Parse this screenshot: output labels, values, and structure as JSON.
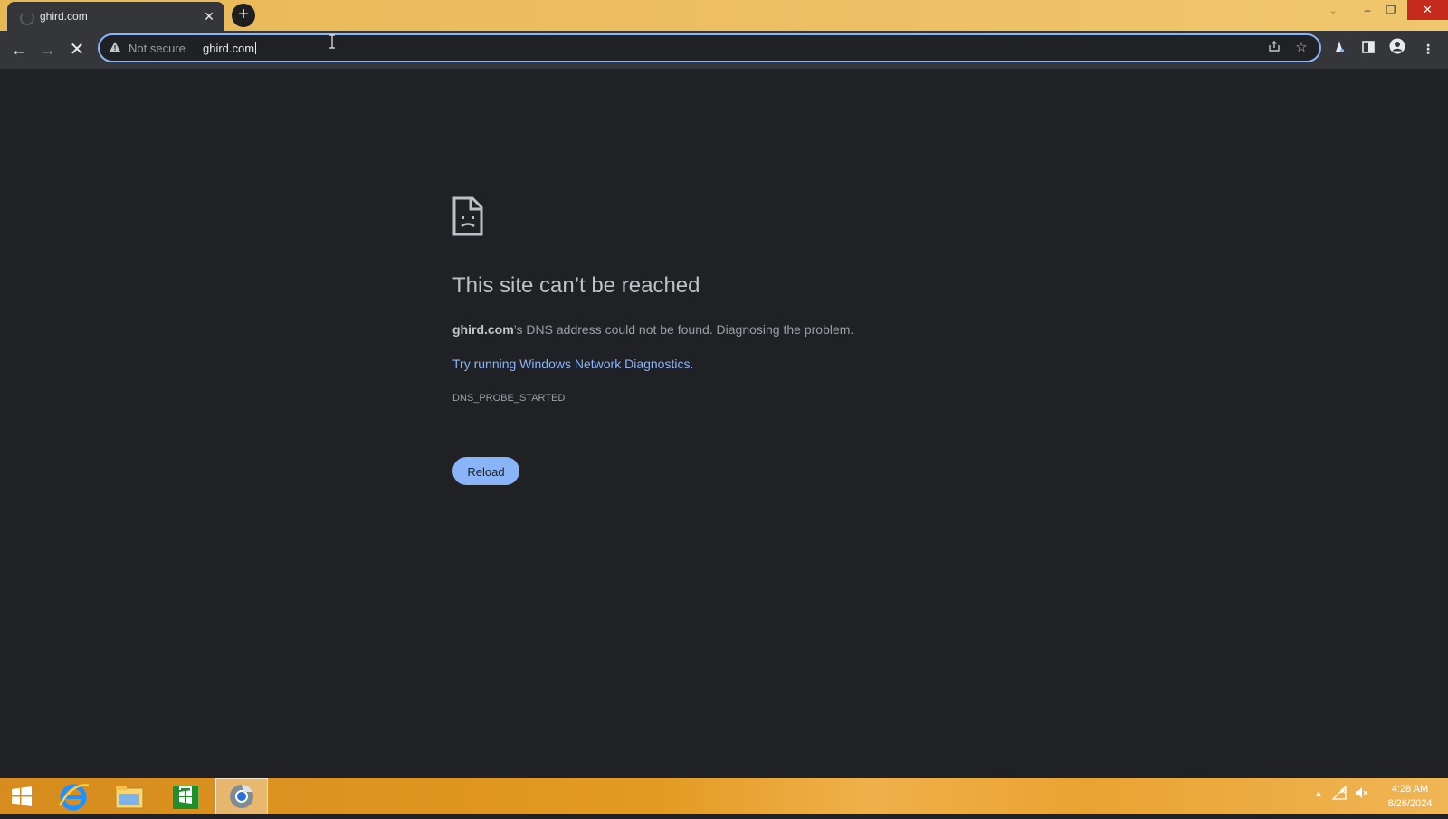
{
  "browser": {
    "tab": {
      "title": "ghird.com",
      "close_glyph": "✕"
    },
    "new_tab_glyph": "+",
    "window_controls": {
      "minimize": "–",
      "maximize": "❐",
      "close": "✕",
      "tab_search": "⌄"
    },
    "nav": {
      "back": "←",
      "forward": "→",
      "stop": "✕"
    },
    "omnibox": {
      "security_label": "Not secure",
      "warning_icon": "warning-icon",
      "url": "ghird.com"
    },
    "toolbar_icons": [
      "share-icon",
      "bookmark-star-icon",
      "extensions-icon",
      "side-panel-icon",
      "profile-icon",
      "menu-icon"
    ]
  },
  "error_page": {
    "icon": "sad-document-icon",
    "title": "This site can’t be reached",
    "host": "ghird.com",
    "description_rest": "’s DNS address could not be found. Diagnosing the problem.",
    "suggestion_link": "Try running Windows Network Diagnostics.",
    "error_code": "DNS_PROBE_STARTED",
    "reload_label": "Reload"
  },
  "taskbar": {
    "items": [
      "windows-start",
      "internet-explorer",
      "file-explorer",
      "windows-store",
      "chrome"
    ],
    "clock": {
      "time": "4:28 AM",
      "date": "8/26/2024"
    }
  },
  "colors": {
    "page_bg": "#202124",
    "link": "#8ab4f8",
    "button_bg": "#8ab4f8",
    "titlebar": "#eec065",
    "taskbar": "#e39a22"
  }
}
